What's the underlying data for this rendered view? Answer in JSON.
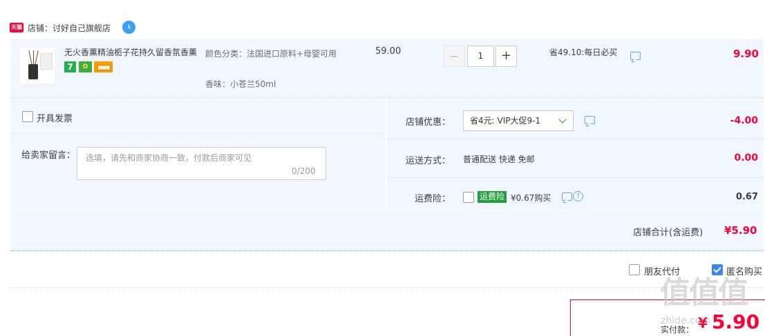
{
  "shop": {
    "badge": "天猫",
    "label": "店铺：讨好自己旗舰店"
  },
  "item": {
    "title": "无火香薰精油栀子花持久留香氛香薰",
    "badge_7": "7",
    "badge_shield": "✿",
    "sku_color": "颜色分类：法国进口原料+母婴可用",
    "sku_scent": "香味：小苍兰50ml",
    "price": "59.00",
    "qty_minus": "−",
    "quantity": "1",
    "qty_plus": "+",
    "saving": "省49.10:每日必买",
    "subtotal": "9.90"
  },
  "options": {
    "invoice_label": "开具发票",
    "memo_label": "给卖家留言：",
    "memo_placeholder": "选填，请先和商家协商一致，付款后商家可见",
    "memo_count": "0/200",
    "shop_promo_label": "店铺优惠：",
    "shop_promo_value": "省4元: VIP大促9-1",
    "shop_promo_amount": "-4.00",
    "delivery_label": "运送方式：",
    "delivery_value": "普通配送 快递 免邮",
    "delivery_amount": "0.00",
    "insurance_label": "运费险：",
    "insurance_badge": "运费险",
    "insurance_value": "¥0.67购买",
    "insurance_help": "?",
    "insurance_amount": "0.67"
  },
  "shop_total": {
    "label": "店铺合计(含运费)",
    "value": "¥5.90"
  },
  "bottom": {
    "friend_pay": "朋友代付",
    "anonymous": "匿名购买",
    "pay_label": "实付款：",
    "pay_yen": "¥",
    "pay_value": "5.90"
  },
  "watermark": {
    "logo": "值值值",
    "text": "zhide.com"
  },
  "colors": {
    "accent_red": "#ff0036",
    "panel_bg": "#f2f7ff",
    "checkbox_blue": "#3e86ee"
  }
}
